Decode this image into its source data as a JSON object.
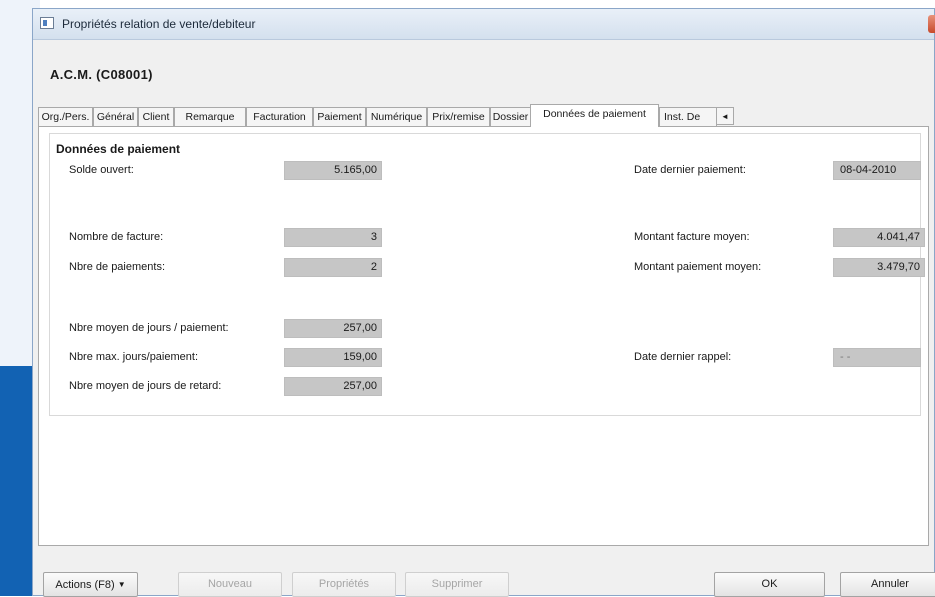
{
  "window": {
    "title": "Propriétés relation de vente/debiteur"
  },
  "heading": "A.C.M. (C08001)",
  "tabs": [
    "Org./Pers.",
    "Général",
    "Client",
    "Remarque",
    "Facturation",
    "Paiement",
    "Numérique",
    "Prix/remise",
    "Dossier",
    "Données de paiement",
    "Inst. De"
  ],
  "active_tab": "Données de paiement",
  "tab_scroll_icon": "arrow-left-icon",
  "group_title": "Données de paiement",
  "fields": {
    "solde_ouvert": {
      "label": "Solde ouvert:",
      "value": "5.165,00"
    },
    "date_dernier_paiement": {
      "label": "Date dernier paiement:",
      "value": "08-04-2010"
    },
    "nombre_facture": {
      "label": "Nombre de facture:",
      "value": "3"
    },
    "montant_facture_moyen": {
      "label": "Montant facture moyen:",
      "value": "4.041,47"
    },
    "nbre_paiements": {
      "label": "Nbre de paiements:",
      "value": "2"
    },
    "montant_paiement_moyen": {
      "label": "Montant paiement moyen:",
      "value": "3.479,70"
    },
    "nbre_moyen_jours_paiement": {
      "label": "Nbre moyen de jours / paiement:",
      "value": "257,00"
    },
    "nbre_max_jours_paiement": {
      "label": "Nbre max. jours/paiement:",
      "value": "159,00"
    },
    "date_dernier_rappel": {
      "label": "Date dernier rappel:",
      "value": "- -"
    },
    "nbre_moyen_jours_retard": {
      "label": "Nbre moyen de jours de retard:",
      "value": "257,00"
    }
  },
  "buttons": {
    "actions": "Actions (F8)",
    "nouveau": "Nouveau",
    "proprietes": "Propriétés",
    "supprimer": "Supprimer",
    "ok": "OK",
    "annuler": "Annuler"
  },
  "colors": {
    "accent_blue": "#1262b3",
    "field_gray": "#c6c6c6",
    "dialog_bg": "#f0f0f0"
  }
}
